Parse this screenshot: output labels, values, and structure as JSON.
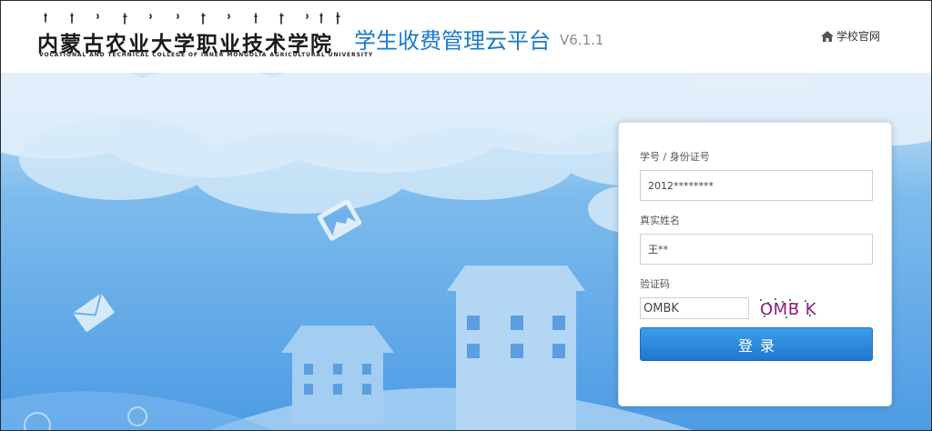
{
  "header": {
    "school_name_cn": "内蒙古农业大学职业技术学院",
    "school_name_en": "VOCATIONAL AND TECHNICAL COLLEGE OF INNER MONGOLIA AGRICULTURAL UNIVERSITY",
    "app_title": "学生收费管理云平台",
    "app_version": "V6.1.1",
    "home_link_label": "学校官网",
    "home_link_icon": "home-icon"
  },
  "colors": {
    "title_blue": "#1a79c9",
    "sky_blue": "#5aa3e6",
    "button_blue": "#1f78cf",
    "captcha_purple": "#8b1a7a"
  },
  "login": {
    "id_label": "学号 / 身份证号",
    "id_value": "2012********",
    "name_label": "真实姓名",
    "name_value": "王**",
    "captcha_label": "验证码",
    "captcha_value": "OMBK",
    "captcha_image_text": "OMB K",
    "submit_label": "登录"
  }
}
